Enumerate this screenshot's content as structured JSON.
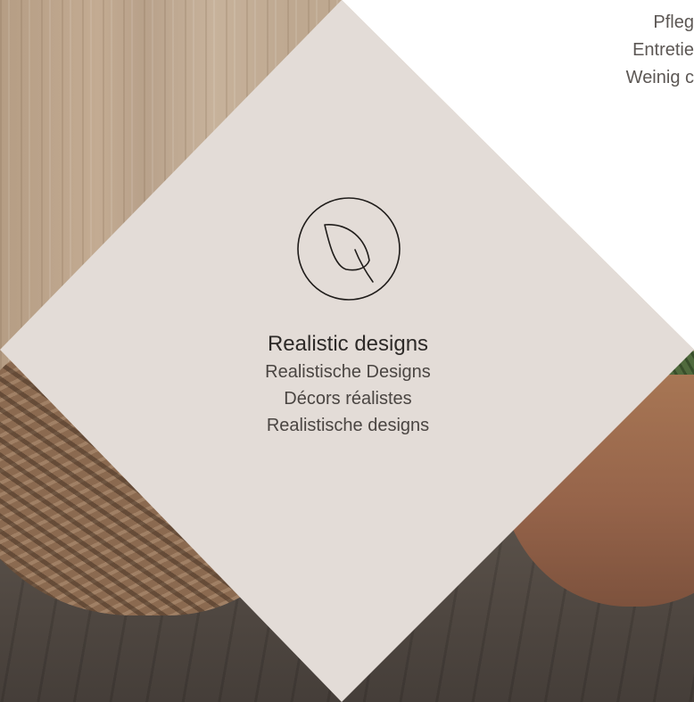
{
  "feature": {
    "icon": "leaf-icon",
    "title": "Realistic designs",
    "lines": [
      "Realistische Designs",
      "Décors réalistes",
      "Realistische designs"
    ]
  },
  "neighbor_feature": {
    "lines": [
      "Pfleg",
      "Entretie",
      "Weinig c"
    ]
  },
  "colors": {
    "diamond": "#e3dcd7",
    "text": "#3a3634",
    "background": "#ffffff"
  }
}
